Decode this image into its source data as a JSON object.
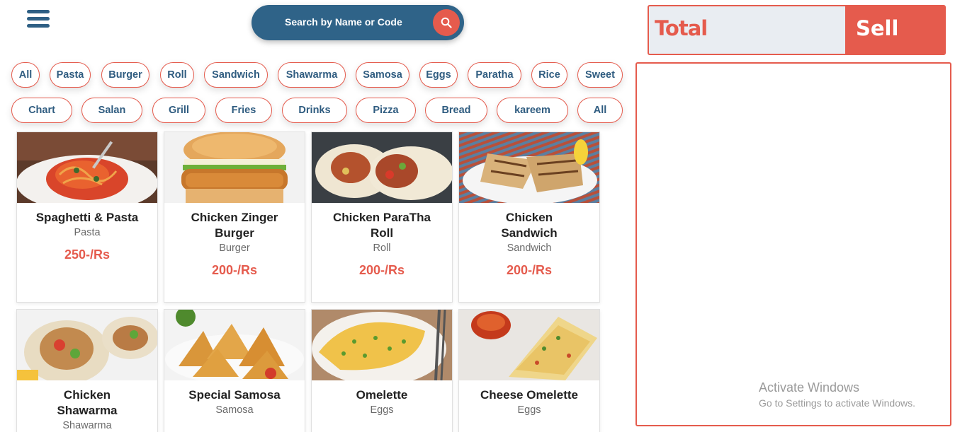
{
  "search": {
    "placeholder": "Search by Name or Code"
  },
  "categories_row1": [
    "All",
    "Pasta",
    "Burger",
    "Roll",
    "Sandwich",
    "Shawarma",
    "Samosa",
    "Eggs",
    "Paratha",
    "Rice",
    "Sweet"
  ],
  "categories_row2": [
    "Chart",
    "Salan",
    "Grill",
    "Fries",
    "Drinks",
    "Pizza",
    "Bread",
    "kareem",
    "All"
  ],
  "products": [
    {
      "name": "Spaghetti & Pasta",
      "category": "Pasta",
      "price": "250-/Rs"
    },
    {
      "name": "Chicken Zinger Burger",
      "category": "Burger",
      "price": "200-/Rs"
    },
    {
      "name": "Chicken ParaTha Roll",
      "category": "Roll",
      "price": "200-/Rs"
    },
    {
      "name": "Chicken Sandwich",
      "category": "Sandwich",
      "price": "200-/Rs"
    },
    {
      "name": "Chicken Shawarma",
      "category": "Shawarma",
      "price": ""
    },
    {
      "name": "Special Samosa",
      "category": "Samosa",
      "price": ""
    },
    {
      "name": "Omelette",
      "category": "Eggs",
      "price": ""
    },
    {
      "name": "Cheese Omelette",
      "category": "Eggs",
      "price": ""
    }
  ],
  "order": {
    "total_label": "Total",
    "sell_label": "Sell"
  },
  "watermark": {
    "line1": "Activate Windows",
    "line2": "Go to Settings to activate Windows."
  },
  "colors": {
    "accent": "#e55b4d",
    "primary": "#2f6388"
  }
}
